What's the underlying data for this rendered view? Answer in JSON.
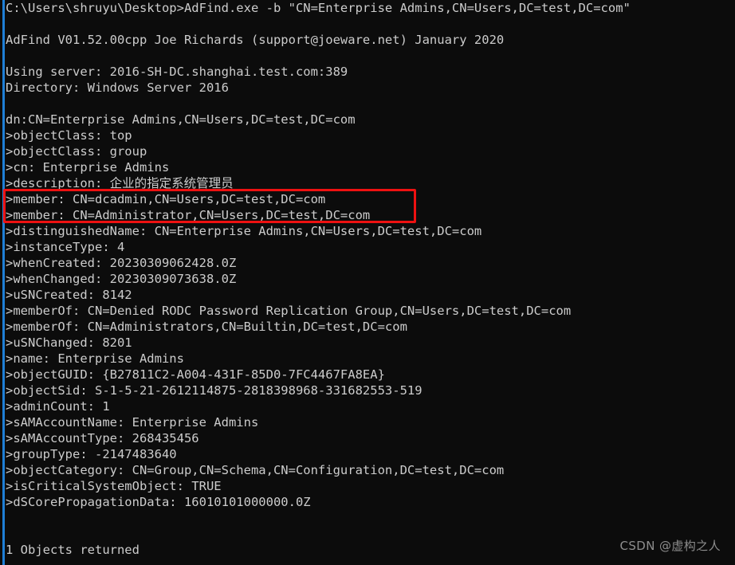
{
  "window": {
    "title": "AdFind console output",
    "background_color": "#0c0c0c",
    "text_color": "#cccccc",
    "accent_rail_color": "#1f7fd6",
    "highlight_color": "#ee1111"
  },
  "terminal": {
    "prompt_line": "C:\\Users\\shruyu\\Desktop>AdFind.exe -b \"CN=Enterprise Admins,CN=Users,DC=test,DC=com\"",
    "lines": [
      "C:\\Users\\shruyu\\Desktop>AdFind.exe -b \"CN=Enterprise Admins,CN=Users,DC=test,DC=com\"",
      "",
      "AdFind V01.52.00cpp Joe Richards (support@joeware.net) January 2020",
      "",
      "Using server: 2016-SH-DC.shanghai.test.com:389",
      "Directory: Windows Server 2016",
      "",
      "dn:CN=Enterprise Admins,CN=Users,DC=test,DC=com",
      ">objectClass: top",
      ">objectClass: group",
      ">cn: Enterprise Admins",
      ">description: 企业的指定系统管理员",
      ">member: CN=dcadmin,CN=Users,DC=test,DC=com",
      ">member: CN=Administrator,CN=Users,DC=test,DC=com",
      ">distinguishedName: CN=Enterprise Admins,CN=Users,DC=test,DC=com",
      ">instanceType: 4",
      ">whenCreated: 20230309062428.0Z",
      ">whenChanged: 20230309073638.0Z",
      ">uSNCreated: 8142",
      ">memberOf: CN=Denied RODC Password Replication Group,CN=Users,DC=test,DC=com",
      ">memberOf: CN=Administrators,CN=Builtin,DC=test,DC=com",
      ">uSNChanged: 8201",
      ">name: Enterprise Admins",
      ">objectGUID: {B27811C2-A004-431F-85D0-7FC4467FA8EA}",
      ">objectSid: S-1-5-21-2612114875-2818398968-331682553-519",
      ">adminCount: 1",
      ">sAMAccountName: Enterprise Admins",
      ">sAMAccountType: 268435456",
      ">groupType: -2147483640",
      ">objectCategory: CN=Group,CN=Schema,CN=Configuration,DC=test,DC=com",
      ">isCriticalSystemObject: TRUE",
      ">dSCorePropagationData: 16010101000000.0Z",
      "",
      "",
      "1 Objects returned"
    ],
    "result_summary": "1 Objects returned"
  },
  "command": {
    "shell_path": "C:\\Users\\shruyu\\Desktop",
    "executable": "AdFind.exe",
    "switch": "-b",
    "base_dn": "CN=Enterprise Admins,CN=Users,DC=test,DC=com"
  },
  "program_banner": {
    "name": "AdFind",
    "version": "V01.52.00cpp",
    "author": "Joe Richards",
    "contact": "support@joeware.net",
    "date": "January 2020"
  },
  "connection": {
    "server_label": "Using server:",
    "server": "2016-SH-DC.shanghai.test.com:389",
    "directory_label": "Directory:",
    "directory": "Windows Server 2016"
  },
  "ldap_object": {
    "dn": "CN=Enterprise Admins,CN=Users,DC=test,DC=com",
    "attributes": [
      {
        "name": "objectClass",
        "value": "top"
      },
      {
        "name": "objectClass",
        "value": "group"
      },
      {
        "name": "cn",
        "value": "Enterprise Admins"
      },
      {
        "name": "description",
        "value": "企业的指定系统管理员"
      },
      {
        "name": "member",
        "value": "CN=dcadmin,CN=Users,DC=test,DC=com"
      },
      {
        "name": "member",
        "value": "CN=Administrator,CN=Users,DC=test,DC=com"
      },
      {
        "name": "distinguishedName",
        "value": "CN=Enterprise Admins,CN=Users,DC=test,DC=com"
      },
      {
        "name": "instanceType",
        "value": "4"
      },
      {
        "name": "whenCreated",
        "value": "20230309062428.0Z"
      },
      {
        "name": "whenChanged",
        "value": "20230309073638.0Z"
      },
      {
        "name": "uSNCreated",
        "value": "8142"
      },
      {
        "name": "memberOf",
        "value": "CN=Denied RODC Password Replication Group,CN=Users,DC=test,DC=com"
      },
      {
        "name": "memberOf",
        "value": "CN=Administrators,CN=Builtin,DC=test,DC=com"
      },
      {
        "name": "uSNChanged",
        "value": "8201"
      },
      {
        "name": "name",
        "value": "Enterprise Admins"
      },
      {
        "name": "objectGUID",
        "value": "{B27811C2-A004-431F-85D0-7FC4467FA8EA}"
      },
      {
        "name": "objectSid",
        "value": "S-1-5-21-2612114875-2818398968-331682553-519"
      },
      {
        "name": "adminCount",
        "value": "1"
      },
      {
        "name": "sAMAccountName",
        "value": "Enterprise Admins"
      },
      {
        "name": "sAMAccountType",
        "value": "268435456"
      },
      {
        "name": "groupType",
        "value": "-2147483640"
      },
      {
        "name": "objectCategory",
        "value": "CN=Group,CN=Schema,CN=Configuration,DC=test,DC=com"
      },
      {
        "name": "isCriticalSystemObject",
        "value": "TRUE"
      },
      {
        "name": "dSCorePropagationData",
        "value": "16010101000000.0Z"
      }
    ]
  },
  "annotation": {
    "highlight_box": {
      "color": "#ee1111",
      "covers": [
        ">member: CN=dcadmin,CN=Users,DC=test,DC=com",
        ">member: CN=Administrator,CN=Users,DC=test,DC=com"
      ]
    }
  },
  "watermark": {
    "text": "CSDN @虚构之人"
  }
}
